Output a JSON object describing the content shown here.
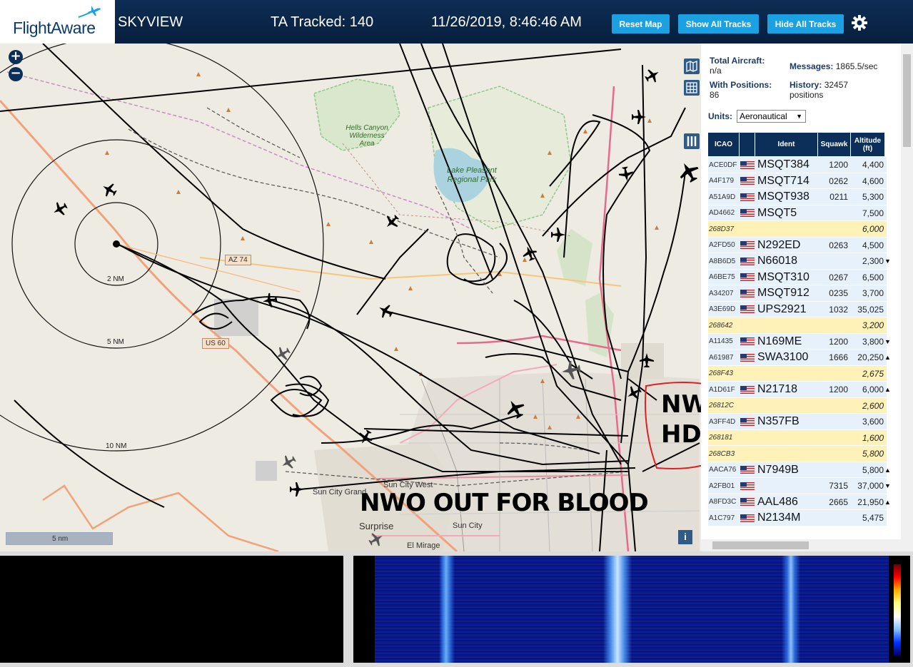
{
  "header": {
    "logo": "FlightAware",
    "title": "SKYVIEW",
    "tracked_label": "TA Tracked: 140",
    "datetime": "11/26/2019, 8:46:46 AM",
    "buttons": {
      "reset": "Reset Map",
      "show": "Show All Tracks",
      "hide": "Hide All Tracks"
    }
  },
  "map": {
    "range_rings": [
      "2 NM",
      "5 NM",
      "10 NM"
    ],
    "scale_label": "5 nm",
    "places": {
      "hells_canyon": "Hells Canyon Wilderness Area",
      "lake_pleasant": "Lake Pleasant Regional Park",
      "sun_city_grand": "Sun City Grand",
      "sun_city_west": "Sun City West",
      "surprise": "Surprise",
      "sun_city": "Sun City",
      "el_mirage": "El Mirage"
    },
    "roads": {
      "az74": "AZ 74",
      "us60": "US 60"
    },
    "annotation_main": "NWO OUT FOR BLOOD",
    "annotation_nwo": "NWO",
    "annotation_hdq": "HDQ",
    "info": "i"
  },
  "panel": {
    "total_aircraft_label": "Total Aircraft:",
    "total_aircraft_value": "n/a",
    "messages_label": "Messages:",
    "messages_value": "1865.5/sec",
    "with_positions_label": "With Positions:",
    "with_positions_value": "86",
    "history_label": "History:",
    "history_value": "32457 positions",
    "units_label": "Units:",
    "units_value": "Aeronautical",
    "columns": [
      "ICAO",
      "Ident",
      "Squawk",
      "Altitude (ft)"
    ],
    "rows": [
      {
        "icao": "ACE0DF",
        "flag": true,
        "ident": "MSQT384",
        "squawk": "1200",
        "alt": "4,400",
        "arrow": "",
        "hl": false
      },
      {
        "icao": "A4F179",
        "flag": true,
        "ident": "MSQT714",
        "squawk": "0262",
        "alt": "4,600",
        "arrow": "",
        "hl": false
      },
      {
        "icao": "A51A9D",
        "flag": true,
        "ident": "MSQT938",
        "squawk": "0211",
        "alt": "5,300",
        "arrow": "",
        "hl": false
      },
      {
        "icao": "AD4662",
        "flag": true,
        "ident": "MSQT5",
        "squawk": "",
        "alt": "7,500",
        "arrow": "",
        "hl": false
      },
      {
        "icao": "268D37",
        "flag": false,
        "ident": "",
        "squawk": "",
        "alt": "6,000",
        "arrow": "",
        "hl": true
      },
      {
        "icao": "A2FD50",
        "flag": true,
        "ident": "N292ED",
        "squawk": "0263",
        "alt": "4,500",
        "arrow": "",
        "hl": false
      },
      {
        "icao": "A8B6D5",
        "flag": true,
        "ident": "N66018",
        "squawk": "",
        "alt": "2,300",
        "arrow": "▼",
        "hl": false
      },
      {
        "icao": "A6BE75",
        "flag": true,
        "ident": "MSQT310",
        "squawk": "0267",
        "alt": "6,500",
        "arrow": "",
        "hl": false
      },
      {
        "icao": "A34207",
        "flag": true,
        "ident": "MSQT912",
        "squawk": "0235",
        "alt": "3,700",
        "arrow": "",
        "hl": false
      },
      {
        "icao": "A3E69D",
        "flag": true,
        "ident": "UPS2921",
        "squawk": "1032",
        "alt": "35,025",
        "arrow": "",
        "hl": false
      },
      {
        "icao": "268642",
        "flag": false,
        "ident": "",
        "squawk": "",
        "alt": "3,200",
        "arrow": "",
        "hl": true
      },
      {
        "icao": "A11435",
        "flag": true,
        "ident": "N169ME",
        "squawk": "1200",
        "alt": "3,800",
        "arrow": "▼",
        "hl": false
      },
      {
        "icao": "A61987",
        "flag": true,
        "ident": "SWA3100",
        "squawk": "1666",
        "alt": "20,250",
        "arrow": "▲",
        "hl": false
      },
      {
        "icao": "268F43",
        "flag": false,
        "ident": "",
        "squawk": "",
        "alt": "2,675",
        "arrow": "",
        "hl": true
      },
      {
        "icao": "A1D61F",
        "flag": true,
        "ident": "N21718",
        "squawk": "1200",
        "alt": "6,000",
        "arrow": "▲",
        "hl": false
      },
      {
        "icao": "26812C",
        "flag": false,
        "ident": "",
        "squawk": "",
        "alt": "2,600",
        "arrow": "",
        "hl": true
      },
      {
        "icao": "A3FF4D",
        "flag": true,
        "ident": "N357FB",
        "squawk": "",
        "alt": "3,600",
        "arrow": "",
        "hl": false
      },
      {
        "icao": "268181",
        "flag": false,
        "ident": "",
        "squawk": "",
        "alt": "1,600",
        "arrow": "",
        "hl": true
      },
      {
        "icao": "268CB3",
        "flag": false,
        "ident": "",
        "squawk": "",
        "alt": "5,800",
        "arrow": "",
        "hl": true
      },
      {
        "icao": "AACA76",
        "flag": true,
        "ident": "N7949B",
        "squawk": "",
        "alt": "5,800",
        "arrow": "▲",
        "hl": false
      },
      {
        "icao": "A2FB01",
        "flag": true,
        "ident": "",
        "squawk": "7315",
        "alt": "37,000",
        "arrow": "▼",
        "hl": false
      },
      {
        "icao": "A8FD3C",
        "flag": true,
        "ident": "AAL486",
        "squawk": "2665",
        "alt": "21,950",
        "arrow": "▲",
        "hl": false
      },
      {
        "icao": "A1C797",
        "flag": true,
        "ident": "N2134M",
        "squawk": "",
        "alt": "5,475",
        "arrow": "",
        "hl": false
      }
    ]
  }
}
